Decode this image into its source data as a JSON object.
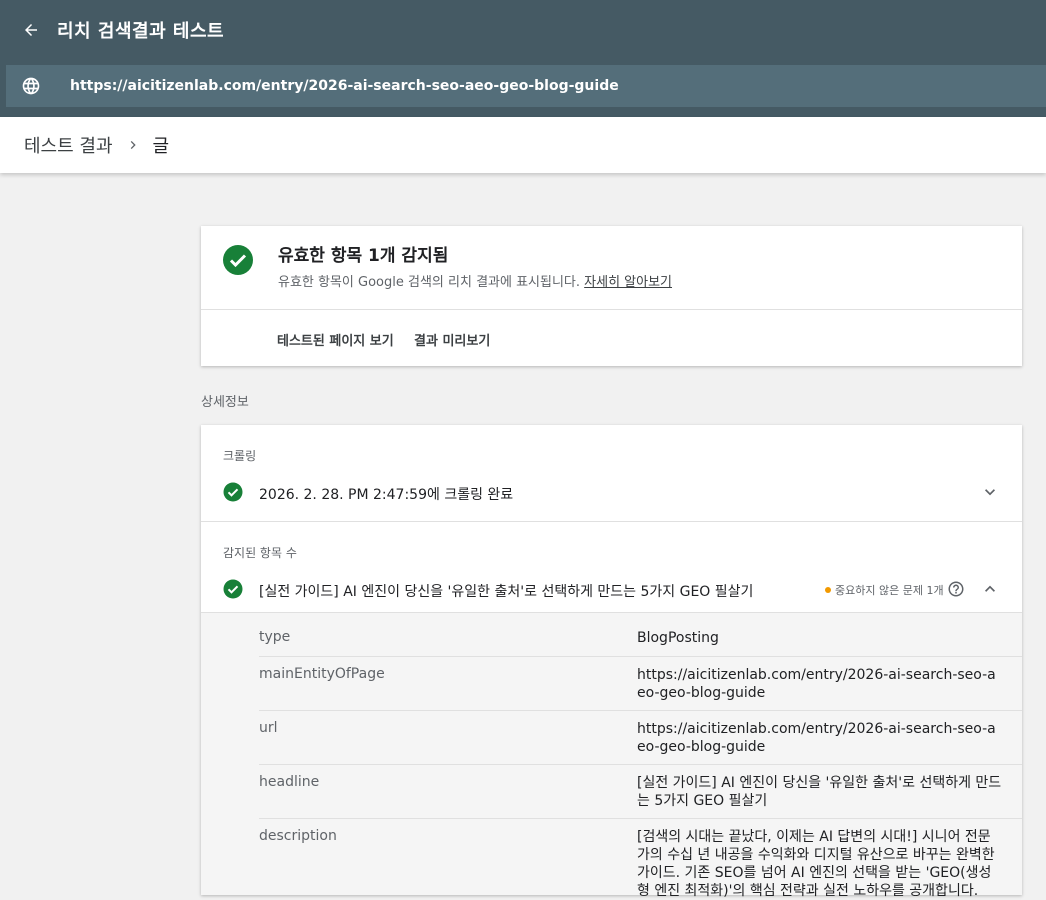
{
  "header": {
    "title": "리치 검색결과 테스트",
    "back_icon": "arrow-back-icon"
  },
  "urlbar": {
    "url": "https://aicitizenlab.com/entry/2026-ai-search-seo-aeo-geo-blog-guide",
    "icon": "globe-icon"
  },
  "breadcrumb": {
    "root": "테스트 결과",
    "current": "글"
  },
  "summary": {
    "heading": "유효한 항목 1개 감지됨",
    "subtext": "유효한 항목이 Google 검색의 리치 결과에 표시됩니다.",
    "learn_more": "자세히 알아보기",
    "view_tested_page": "테스트된 페이지 보기",
    "preview_results": "결과 미리보기",
    "status_color": "#188038"
  },
  "details": {
    "label": "상세정보",
    "crawl": {
      "title": "크롤링",
      "text": "2026. 2. 28. PM 2:47:59에 크롤링 완료"
    },
    "detected": {
      "title": "감지된 항목 수",
      "item": "[실전 가이드] AI 엔진이 당신을 '유일한 출처'로 선택하게 만드는 5가지 GEO 필살기",
      "issue_badge": "중요하지 않은 문제 1개",
      "issue_color": "#f29900",
      "properties": [
        {
          "name": "type",
          "value": "BlogPosting"
        },
        {
          "name": "mainEntityOfPage",
          "value": "https://aicitizenlab.com/entry/2026-ai-search-seo-aeo-geo-blog-guide"
        },
        {
          "name": "url",
          "value": "https://aicitizenlab.com/entry/2026-ai-search-seo-aeo-geo-blog-guide"
        },
        {
          "name": "headline",
          "value": "[실전 가이드] AI 엔진이 당신을 '유일한 출처'로 선택하게 만드는 5가지 GEO 필살기"
        },
        {
          "name": "description",
          "value": "[검색의 시대는 끝났다, 이제는 AI 답변의 시대!] 시니어 전문가의 수십 년 내공을 수익화와 디지털 유산으로 바꾸는 완벽한 가이드. 기존 SEO를 넘어 AI 엔진의 선택을 받는 'GEO(생성형 엔진 최적화)'의 핵심 전략과 실전 노하우를 공개합니다."
        }
      ]
    }
  }
}
